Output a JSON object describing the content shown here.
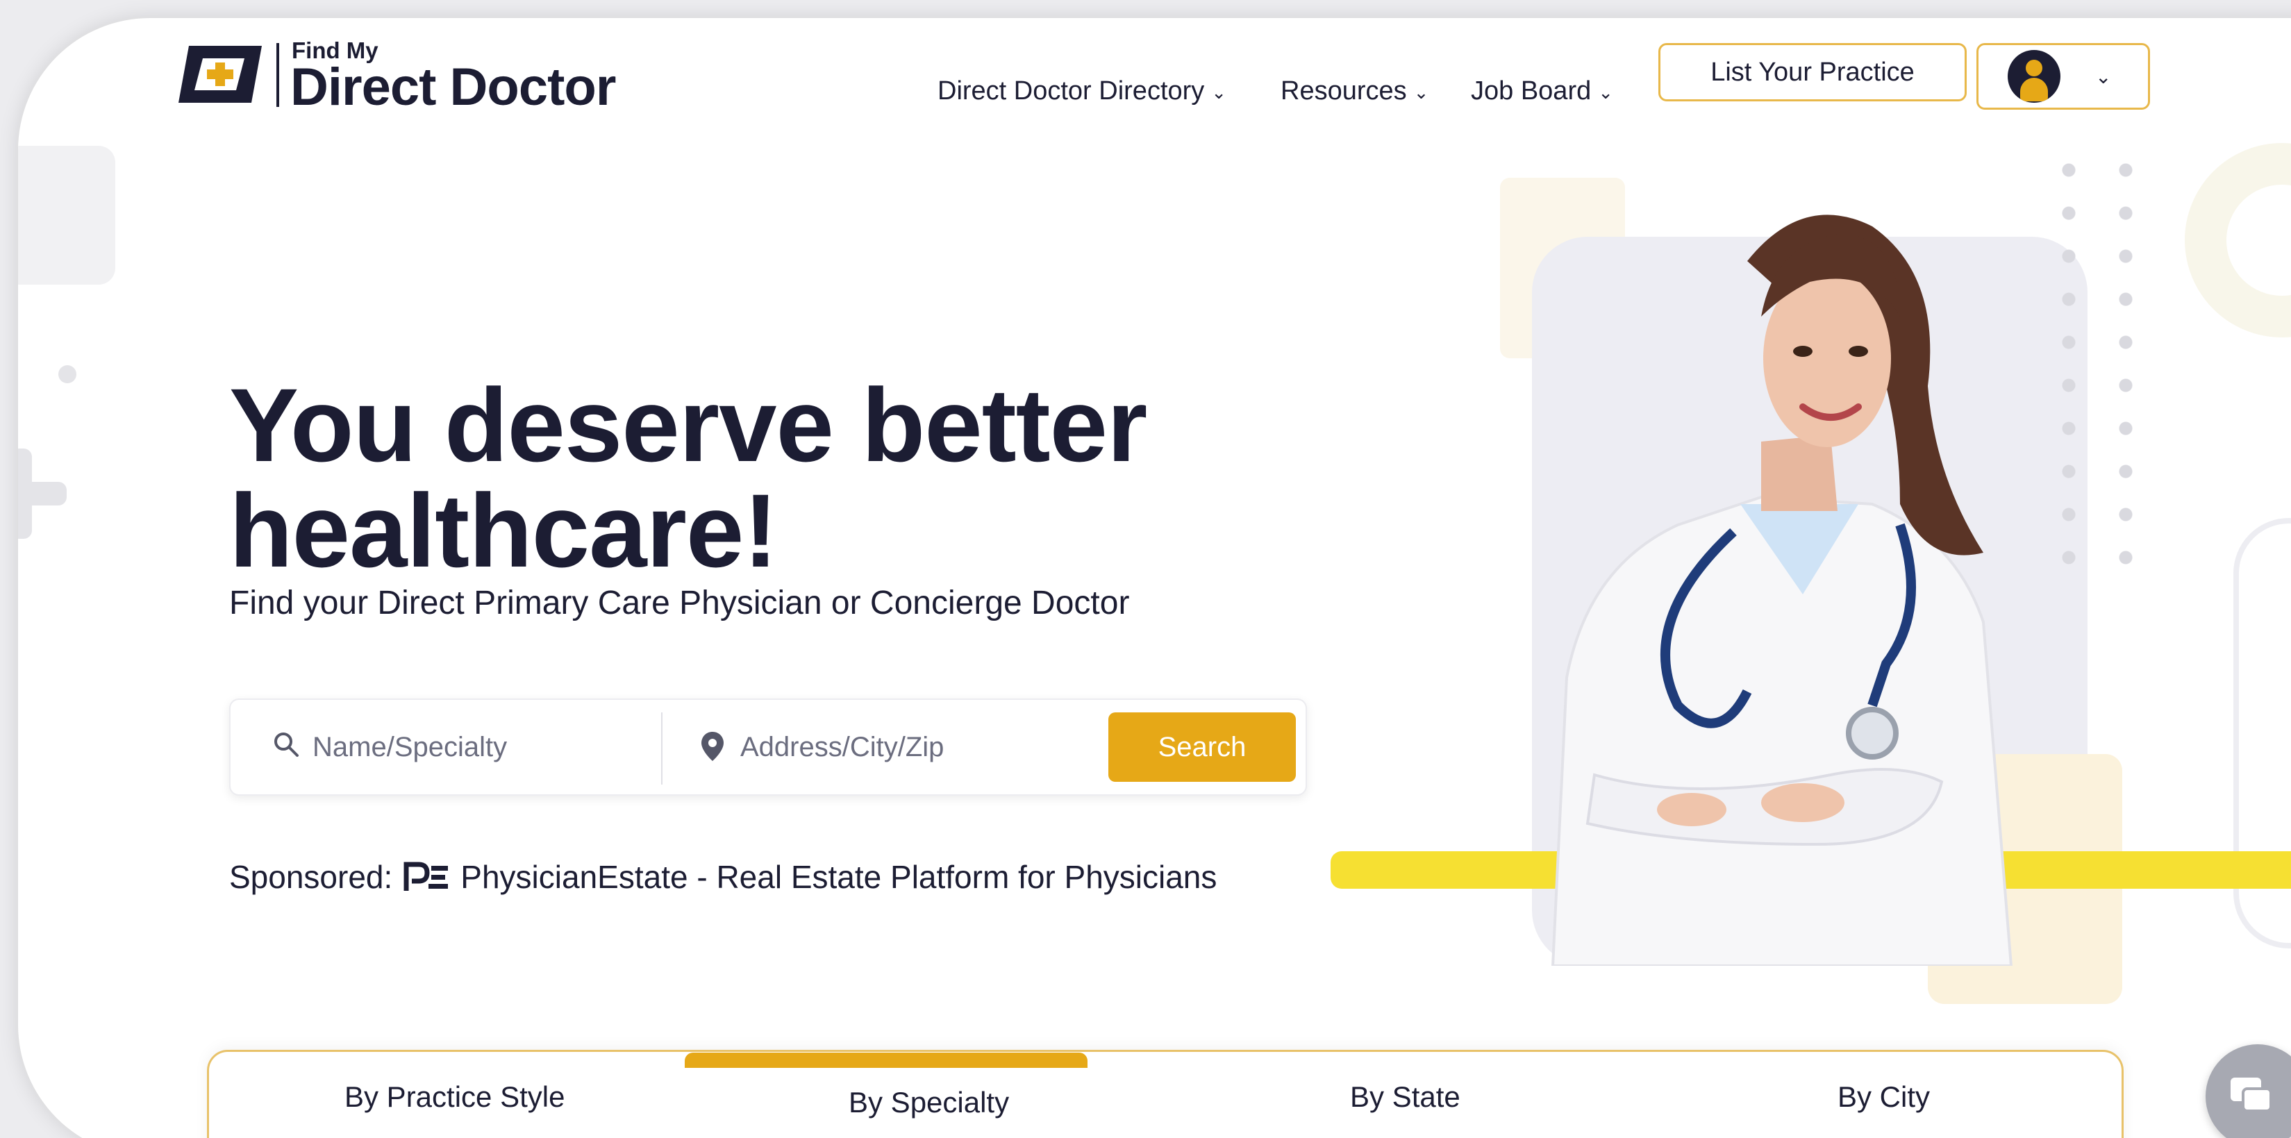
{
  "brand": {
    "small": "Find My",
    "big": "Direct Doctor",
    "accent": "#e6a817",
    "dark": "#1c1d33"
  },
  "nav": {
    "items": [
      {
        "label": "Direct Doctor Directory",
        "icon": "chevron-down-icon"
      },
      {
        "label": "Resources",
        "icon": "chevron-down-icon"
      },
      {
        "label": "Job Board",
        "icon": "chevron-down-icon"
      }
    ],
    "cta": "List Your Practice",
    "profile_icon": "user-avatar-icon"
  },
  "hero": {
    "headline_line1": "You deserve better",
    "headline_line2": "healthcare!",
    "subhead": "Find your Direct Primary Care Physician or Concierge Doctor"
  },
  "search": {
    "name_placeholder": "Name/Specialty",
    "address_placeholder": "Address/City/Zip",
    "button": "Search"
  },
  "sponsored": {
    "label": "Sponsored:",
    "text": "PhysicianEstate - Real Estate Platform for Physicians"
  },
  "tabs": [
    {
      "label": "By Practice Style",
      "active": false
    },
    {
      "label": "By Specialty",
      "active": true
    },
    {
      "label": "By State",
      "active": false
    },
    {
      "label": "By City",
      "active": false
    }
  ],
  "colors": {
    "highlight": "#f6e032",
    "panel": "#ededf3"
  }
}
